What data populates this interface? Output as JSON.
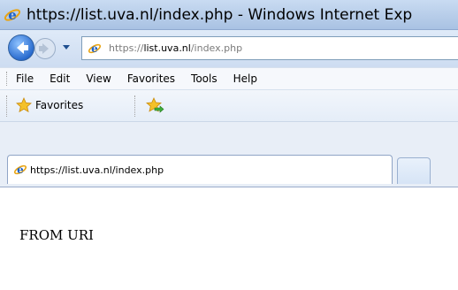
{
  "window": {
    "title": "https://list.uva.nl/index.php - Windows Internet Exp"
  },
  "navbar": {
    "address": {
      "scheme": "https://",
      "host": "list.uva.nl",
      "path": "/index.php"
    }
  },
  "menubar": {
    "items": [
      "File",
      "Edit",
      "View",
      "Favorites",
      "Tools",
      "Help"
    ]
  },
  "favbar": {
    "favorites_label": "Favorites"
  },
  "tabs": [
    {
      "label": "https://list.uva.nl/index.php"
    }
  ],
  "content": {
    "text": "FROM URI"
  },
  "colors": {
    "titlebar": "#b7cde9",
    "accent_blue": "#2a6fd6",
    "star_yellow": "#f4c12a"
  },
  "icons": [
    "ie-icon",
    "back-arrow-icon",
    "forward-arrow-icon",
    "chevron-down-icon",
    "favorites-star-icon",
    "add-favorite-icon"
  ]
}
